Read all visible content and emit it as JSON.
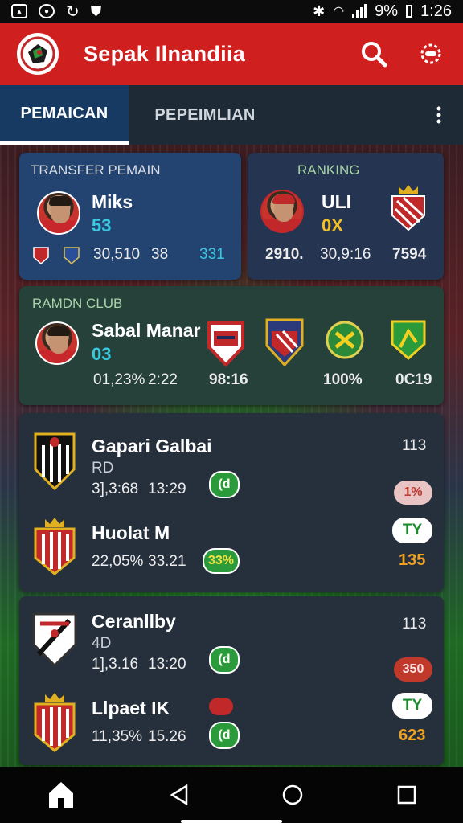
{
  "status_bar": {
    "battery": "9%",
    "time": "1:26"
  },
  "app": {
    "title": "Sepak Ilnandiia"
  },
  "tabs": [
    {
      "label": "PEMAICAN",
      "active": true
    },
    {
      "label": "PEPEIMLIAN",
      "active": false
    }
  ],
  "transfer_card": {
    "heading": "TRANSFER PEMAIN",
    "player_name": "Miks",
    "rating": "53",
    "stat1": "30,510",
    "stat2": "38",
    "stat3": "331"
  },
  "ranking_card": {
    "heading": "RANKING",
    "name": "ULI",
    "badge": "0X",
    "stat1": "2910.",
    "stat2": "30,9:16",
    "stat3": "7594"
  },
  "club_card": {
    "heading": "RAMDN CLUB",
    "player_name": "Sabal Manar",
    "rating": "03",
    "stat1": "01,23%",
    "stat2": "2:22",
    "stat3": "98:16",
    "stat4": "100%",
    "stat5": "0C19"
  },
  "match_group_1": [
    {
      "team": "Gapari Galbai",
      "sub": "RD",
      "stat1": "3],3:68",
      "stat2": "13:29",
      "pill": "(d",
      "right_top": "113",
      "right_pill": "1%",
      "crest_color": "#111"
    },
    {
      "team": "Huolat M",
      "sub": "",
      "stat1": "22,05%",
      "stat2": "33.21",
      "pill": "33%",
      "right_pill": "TY",
      "right_value": "135",
      "crest_color": "#c0282a"
    }
  ],
  "match_group_2": [
    {
      "team": "Ceranllby",
      "sub": "4D",
      "stat1": "1],3.16",
      "stat2": "13:20",
      "pill": "(d",
      "right_top": "113",
      "right_pill": "350",
      "crest_color": "#fff"
    },
    {
      "team": "Llpaet IK",
      "sub": "",
      "stat1": "11,35%",
      "stat2": "15.26",
      "pill": "(d",
      "right_pill": "TY",
      "right_value": "623",
      "crest_color": "#c0282a"
    }
  ],
  "colors": {
    "primary": "#d01f1f",
    "tab_active": "#173a63",
    "accent_cyan": "#38c8e0",
    "accent_yellow": "#f2c020"
  }
}
